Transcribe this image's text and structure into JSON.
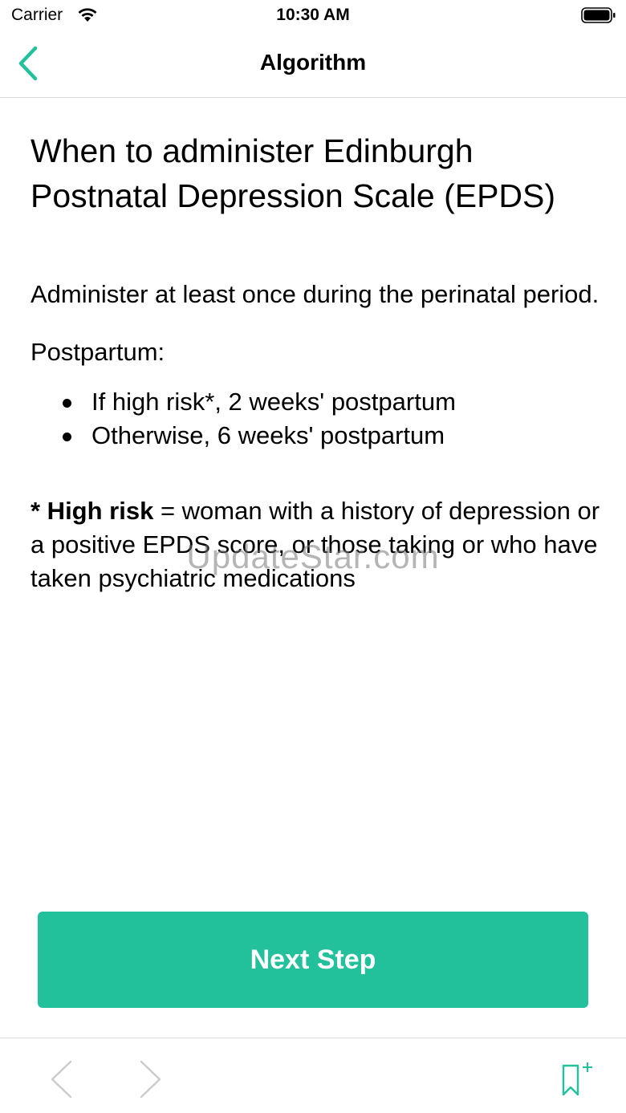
{
  "status_bar": {
    "carrier": "Carrier",
    "time": "10:30 AM"
  },
  "nav": {
    "title": "Algorithm",
    "back_icon": "chevron-left-icon"
  },
  "content": {
    "heading": "When to administer Edinburgh Postnatal Depression Scale (EPDS)",
    "intro": "Administer at least once during the perinatal period.",
    "postpartum_label": "Postpartum:",
    "bullets": [
      "If high risk*, 2 weeks' postpartum",
      "Otherwise, 6 weeks' postpartum"
    ],
    "definition_term": "* High risk",
    "definition_text": " = woman with a history of depression or a positive EPDS score, or those taking or who have taken psychiatric medications"
  },
  "watermark": "UpdateStar.com",
  "next_button": {
    "label": "Next Step"
  },
  "toolbar": {
    "prev_icon": "chevron-left-icon",
    "next_icon": "chevron-right-icon",
    "bookmark_icon": "bookmark-add-icon"
  },
  "colors": {
    "accent": "#23c09c",
    "disabled": "#cccccc",
    "divider": "#d9d9d9"
  }
}
